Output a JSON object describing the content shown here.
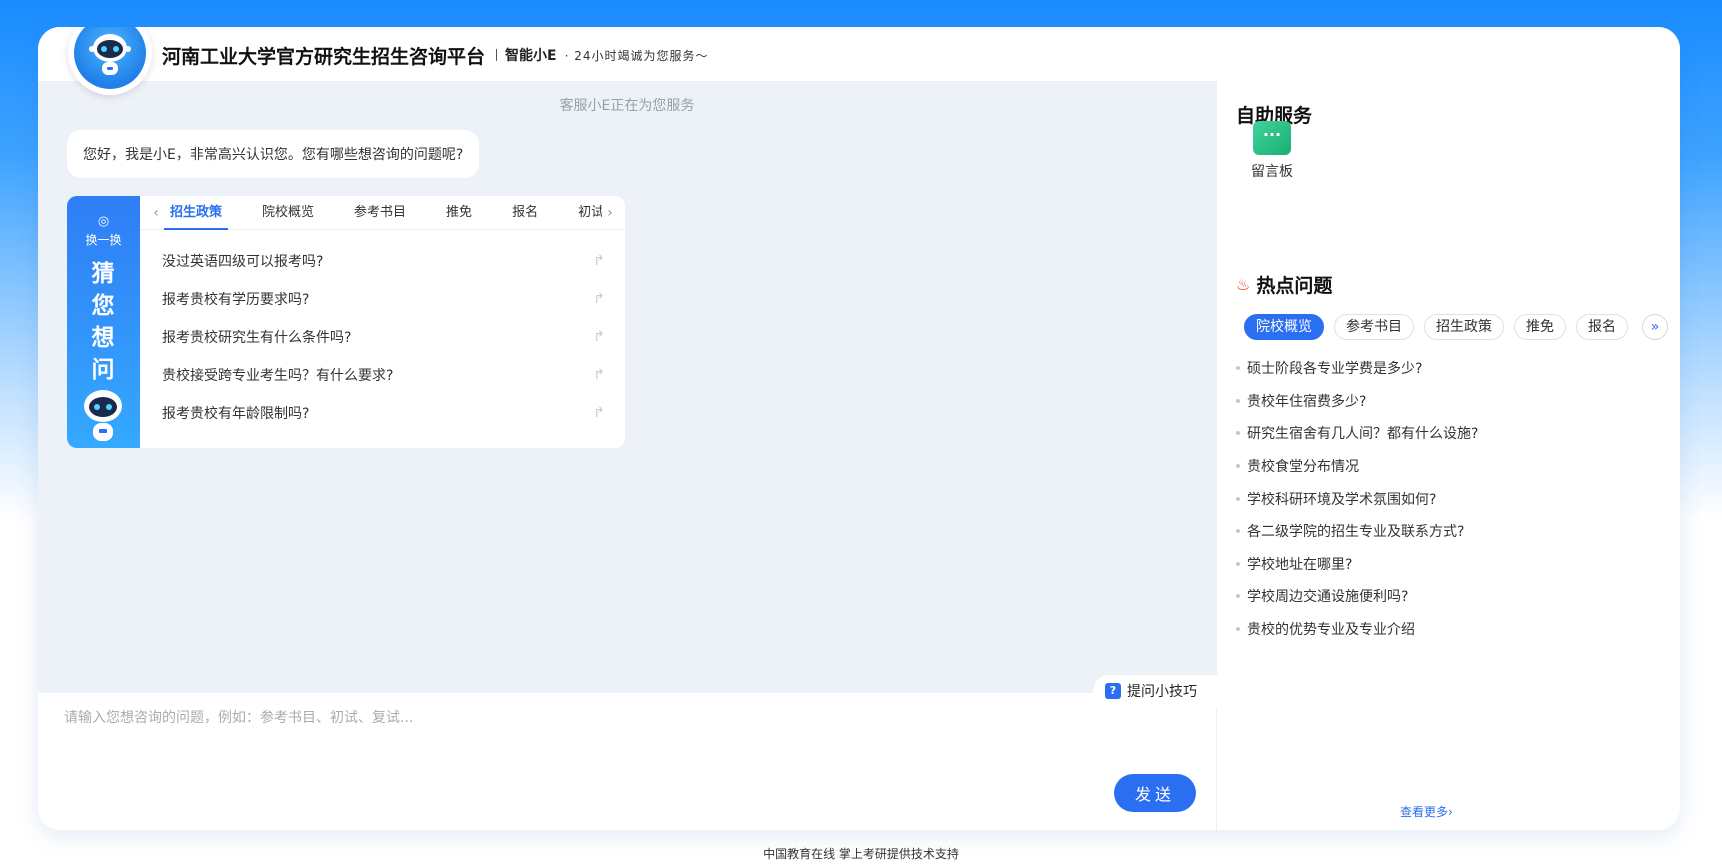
{
  "header": {
    "title": "河南工业大学官方研究生招生咨询平台",
    "brand": "智能小E",
    "slogan": "· 24小时竭诚为您服务～"
  },
  "chat": {
    "service_note": "客服小E正在为您服务",
    "greeting": "您好，我是小E，非常高兴认识您。您有哪些想咨询的问题呢?",
    "guess_panel": {
      "refresh_label": "换一换",
      "side_title": [
        "猜",
        "您",
        "想",
        "问"
      ],
      "tabs": [
        "招生政策",
        "院校概览",
        "参考书目",
        "推免",
        "报名",
        "初试"
      ],
      "active_tab": "招生政策",
      "questions": [
        "没过英语四级可以报考吗?",
        "报考贵校有学历要求吗?",
        "报考贵校研究生有什么条件吗?",
        "贵校接受跨专业考生吗？有什么要求?",
        "报考贵校有年龄限制吗?"
      ]
    },
    "tips_label": "提问小技巧",
    "input_placeholder": "请输入您想咨询的问题，例如：参考书目、初试、复试...",
    "send_label": "发送"
  },
  "sidebar": {
    "self_service_title": "自助服务",
    "message_board_label": "留言板",
    "hot_title": "热点问题",
    "hot_tabs": [
      "院校概览",
      "参考书目",
      "招生政策",
      "推免",
      "报名"
    ],
    "active_hot_tab": "院校概览",
    "hot_questions": [
      "硕士阶段各专业学费是多少?",
      "贵校年住宿费多少?",
      "研究生宿舍有几人间？都有什么设施?",
      "贵校食堂分布情况",
      "学校科研环境及学术氛围如何?",
      "各二级学院的招生专业及联系方式?",
      "学校地址在哪里?",
      "学校周边交通设施便利吗?",
      "贵校的优势专业及专业介绍"
    ],
    "more_link": "查看更多"
  },
  "footer": {
    "text": "中国教育在线 掌上考研提供技术支持"
  },
  "colors": {
    "accent": "#2a6ff1",
    "chat_bg": "#edf1f8",
    "message_board_green": "#1aae72"
  }
}
